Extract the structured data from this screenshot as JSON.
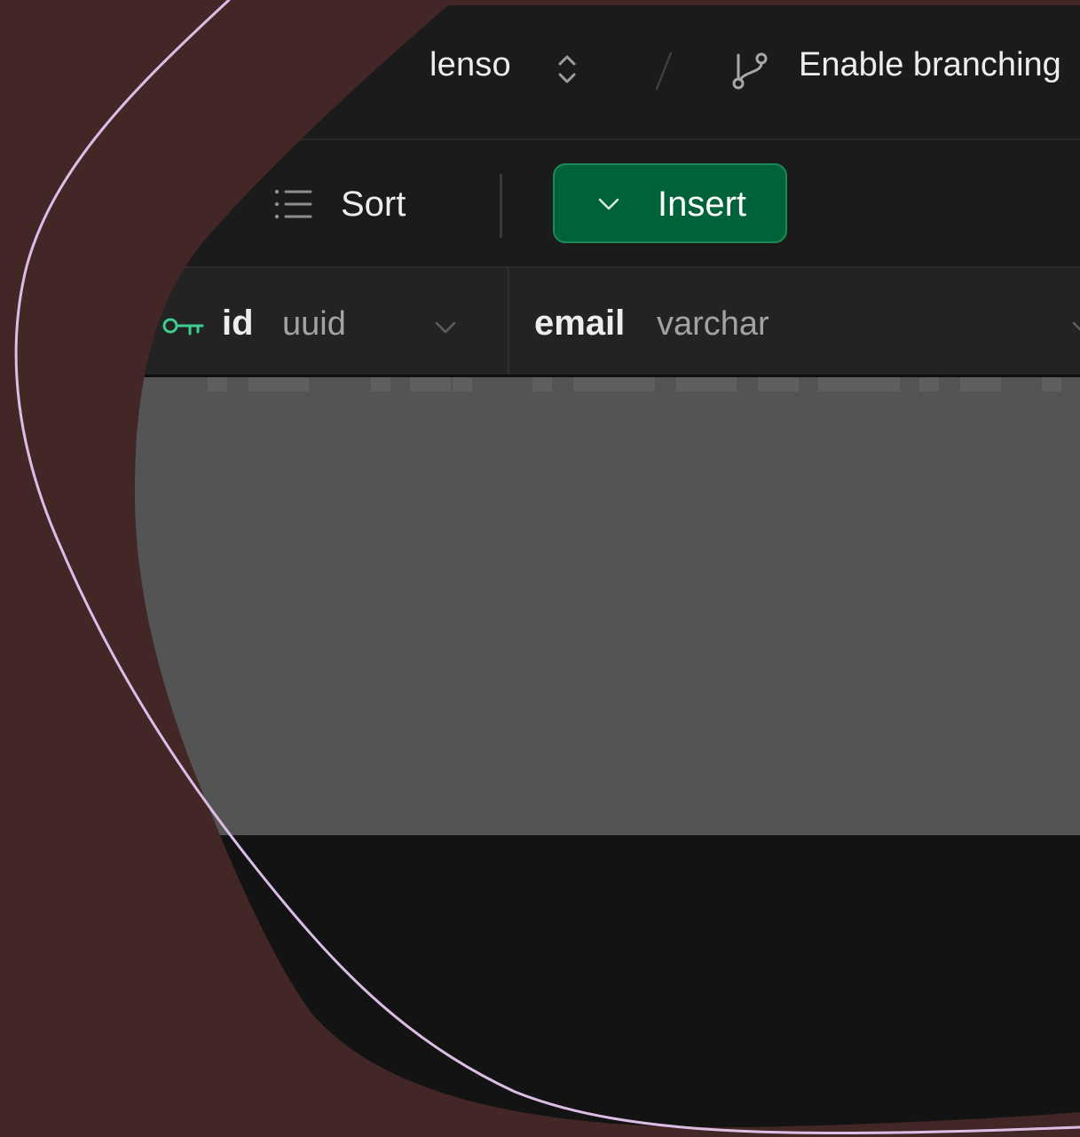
{
  "topbar": {
    "project_name": "lenso",
    "separator": "/",
    "branching_label": "Enable branching"
  },
  "toolbar": {
    "sort_label": "Sort",
    "insert_label": "Insert"
  },
  "table": {
    "columns": [
      {
        "name": "id",
        "type": "uuid",
        "primary_key": true
      },
      {
        "name": "email",
        "type": "varchar",
        "primary_key": false
      }
    ]
  },
  "colors": {
    "accent_green": "#006239",
    "key_icon": "#3ecf8e",
    "background": "#432626",
    "outline": "#dcbde6"
  },
  "icons": [
    "chevrons-up-down-icon",
    "git-branch-icon",
    "list-icon",
    "chevron-down-icon",
    "key-icon"
  ]
}
